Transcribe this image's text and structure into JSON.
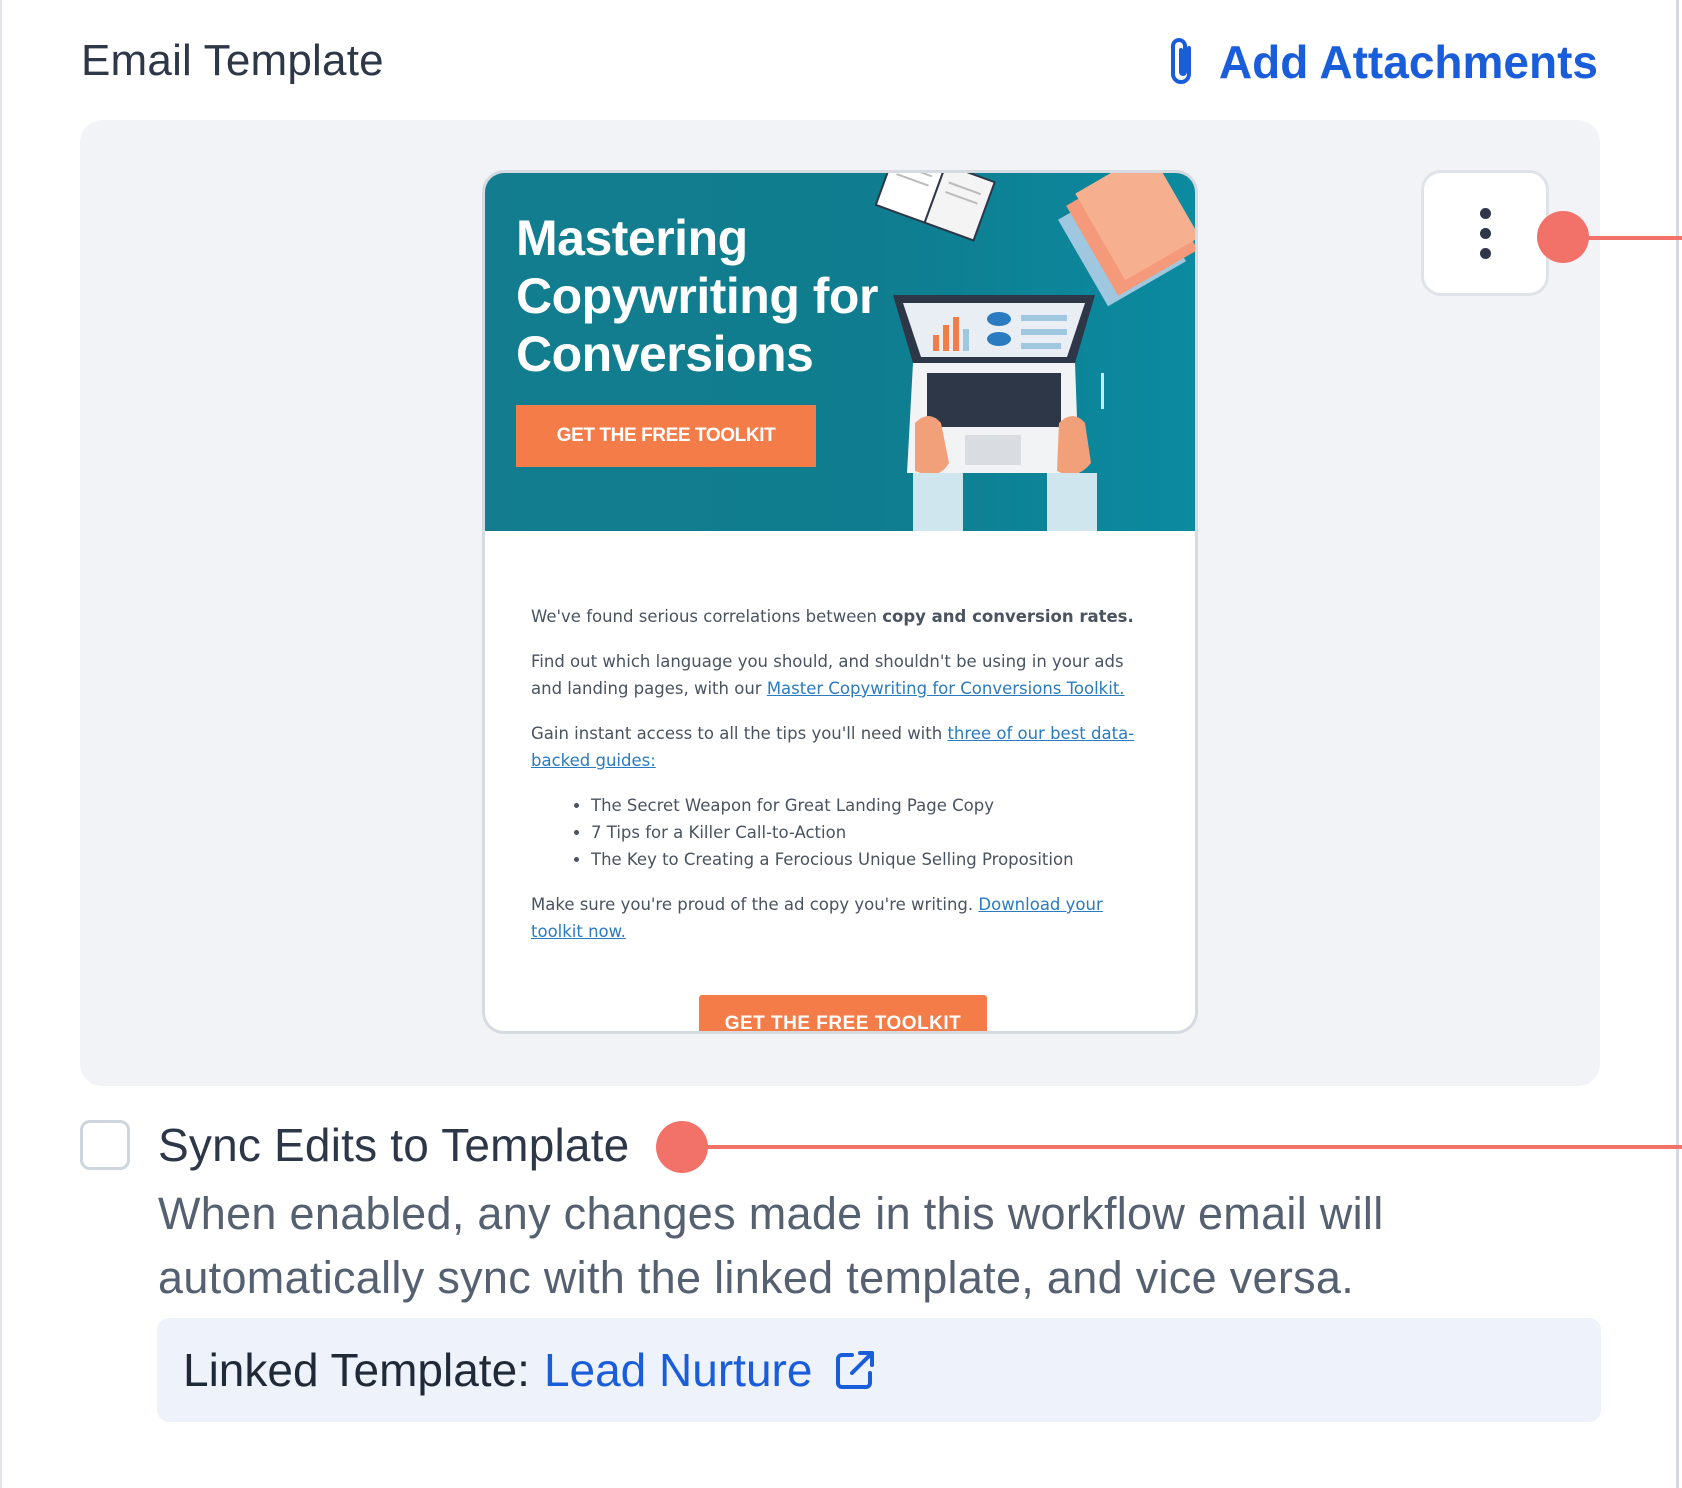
{
  "section": {
    "title": "Email Template",
    "add_attachments_label": "Add Attachments"
  },
  "email_preview": {
    "hero_title_lines": [
      "Mastering",
      "Copywriting for",
      "Conversions"
    ],
    "hero_cta": "GET THE FREE TOOLKIT",
    "paragraph1_text": "We've found serious correlations between ",
    "paragraph1_bold": "copy and conversion rates.",
    "paragraph2_text": "Find out which language you should, and shouldn't be using in your ads and landing pages, with our ",
    "paragraph2_link": "Master Copywriting for Conversions Toolkit.",
    "paragraph3_text": "Gain instant access to all the tips you'll need with ",
    "paragraph3_link": "three of our best data-backed guides:",
    "guides": [
      "The Secret Weapon for Great Landing Page Copy",
      "7 Tips for a Killer Call-to-Action",
      "The Key to Creating a Ferocious Unique Selling Proposition"
    ],
    "paragraph4_text": "Make sure you're proud of the ad copy you're writing. ",
    "paragraph4_link": "Download your toolkit now.",
    "body_cta": "GET THE FREE TOOLKIT"
  },
  "sync": {
    "label": "Sync Edits to Template",
    "checked": false,
    "description": "When enabled, any changes made in this workflow email will automatically sync with the linked template, and vice versa."
  },
  "linked_template": {
    "label": "Linked Template:",
    "name": "Lead Nurture"
  },
  "icons": {
    "attachment": "paperclip-icon",
    "menu": "more-vertical-icon",
    "external": "external-link-icon"
  },
  "colors": {
    "accent": "#1a5ddb",
    "callout": "#f2726a",
    "hero_bg": "#137d8f",
    "cta_orange": "#f47c48"
  }
}
